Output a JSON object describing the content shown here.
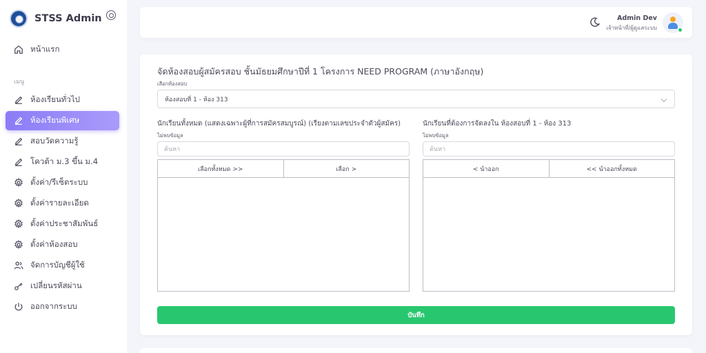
{
  "brand": {
    "name": "STSS Admin"
  },
  "sidebar": {
    "home": "หน้าแรก",
    "section": "เมนู",
    "items": [
      {
        "label": "ห้องเรียนทั่วไป",
        "icon": "pencil-icon"
      },
      {
        "label": "ห้องเรียนพิเศษ",
        "icon": "pencil-icon",
        "active": true
      },
      {
        "label": "สอบวัดความรู้",
        "icon": "pencil-icon"
      },
      {
        "label": "โควต้า ม.3 ขึ้น ม.4",
        "icon": "pencil-icon"
      },
      {
        "label": "ตั้งค่า/รีเซ็ตระบบ",
        "icon": "gear-icon"
      },
      {
        "label": "ตั้งค่ารายละเอียด",
        "icon": "gear-icon"
      },
      {
        "label": "ตั้งค่าประชาสัมพันธ์",
        "icon": "gear-icon"
      },
      {
        "label": "ตั้งค่าห้องสอบ",
        "icon": "gear-icon"
      },
      {
        "label": "จัดการบัญชีผู้ใช้",
        "icon": "users-icon"
      },
      {
        "label": "เปลี่ยนรหัสผ่าน",
        "icon": "key-icon"
      },
      {
        "label": "ออกจากระบบ",
        "icon": "power-icon"
      }
    ]
  },
  "topbar": {
    "user_name": "Admin Dev",
    "user_role": "เจ้าหน้าที่/ผู้ดูแลระบบ"
  },
  "main": {
    "title": "จัดห้องสอบผู้สมัครสอบ ชั้นมัธยมศึกษาปีที่ 1 โครงการ NEED PROGRAM (ภาษาอังกฤษ)",
    "room_select_label": "เลือกห้องสอบ",
    "room_select_value": "ห้องสอบที่ 1 - ห้อง 313",
    "left": {
      "title": "นักเรียนทั้งหมด (แสดงเฉพาะผู้ที่การสมัครสมบูรณ์) (เรียงตามเลขประจำตัวผู้สมัคร)",
      "status": "ไม่พบข้อมูล",
      "search_placeholder": "ค้นหา",
      "btn_all": "เลือกทั้งหมด >>",
      "btn_one": "เลือก >"
    },
    "right": {
      "title": "นักเรียนที่ต้องการจัดลงใน ห้องสอบที่ 1 - ห้อง 313",
      "status": "ไม่พบข้อมูล",
      "search_placeholder": "ค้นหา",
      "btn_one": "< นำออก",
      "btn_all": "<< นำออกทั้งหมด"
    },
    "save_label": "บันทึก"
  },
  "colors": {
    "accent": "#8b7cf6",
    "save": "#28c76f"
  }
}
